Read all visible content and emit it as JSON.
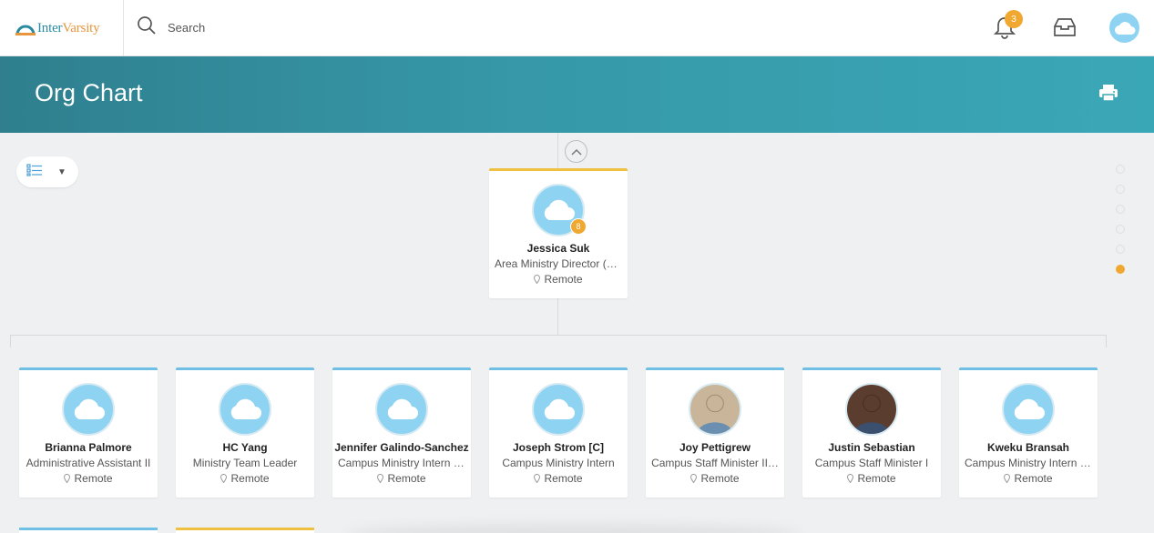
{
  "app": {
    "logo_text_prefix": "Inter",
    "logo_text_suffix": "Varsity",
    "search_placeholder": "Search",
    "notification_count": "3",
    "brand_color": "#f0a830",
    "header_gradient": [
      "#2f7f8e",
      "#3aa7b7"
    ]
  },
  "page": {
    "title": "Org Chart"
  },
  "manager": {
    "name": "Jessica Suk",
    "title": "Area Ministry Director (C…",
    "location": "Remote",
    "reports_count": "8",
    "avatar": "cloud-avatar-icon"
  },
  "reports": [
    {
      "name": "Brianna Palmore",
      "title": "Administrative Assistant II",
      "location": "Remote",
      "avatar": "cloud-avatar-icon"
    },
    {
      "name": "HC Yang",
      "title": "Ministry Team Leader",
      "location": "Remote",
      "avatar": "cloud-avatar-icon"
    },
    {
      "name": "Jennifer Galindo-Sanchez",
      "title": "Campus Ministry Intern (…",
      "location": "Remote",
      "avatar": "cloud-avatar-icon"
    },
    {
      "name": "Joseph Strom [C]",
      "title": "Campus Ministry Intern",
      "location": "Remote",
      "avatar": "cloud-avatar-icon"
    },
    {
      "name": "Joy Pettigrew",
      "title": "Campus Staff Minister II…",
      "location": "Remote",
      "avatar": "photo-avatar"
    },
    {
      "name": "Justin Sebastian",
      "title": "Campus Staff Minister I",
      "location": "Remote",
      "avatar": "photo-avatar"
    },
    {
      "name": "Kweku Bransah",
      "title": "Campus Ministry Intern (…",
      "location": "Remote",
      "avatar": "cloud-avatar-icon"
    }
  ],
  "level_indicator": {
    "levels": 6,
    "active_level": 6
  }
}
